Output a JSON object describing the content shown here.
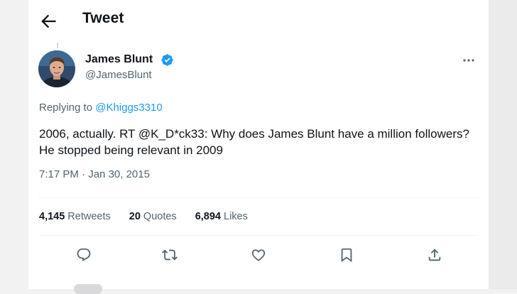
{
  "header": {
    "title": "Tweet",
    "back_icon": "arrow-left-icon"
  },
  "tweet": {
    "author": {
      "display_name": "James Blunt",
      "handle": "@JamesBlunt",
      "verified": true
    },
    "replying_prefix": "Replying to",
    "replying_to": "@Khiggs3310",
    "text": "2006, actually. RT @K_D*ck33: Why does James Blunt have a million followers? He stopped being relevant in 2009",
    "time": "7:17 PM",
    "separator": "·",
    "date": "Jan 30, 2015",
    "stats": {
      "retweets_count": "4,145",
      "retweets_label": "Retweets",
      "quotes_count": "20",
      "quotes_label": "Quotes",
      "likes_count": "6,894",
      "likes_label": "Likes"
    }
  },
  "actions": [
    "reply-icon",
    "retweet-icon",
    "like-icon",
    "bookmark-icon",
    "share-icon"
  ],
  "colors": {
    "accent": "#1d9bf0",
    "text": "#0f1419",
    "muted": "#536471",
    "divider": "#eff3f4"
  }
}
